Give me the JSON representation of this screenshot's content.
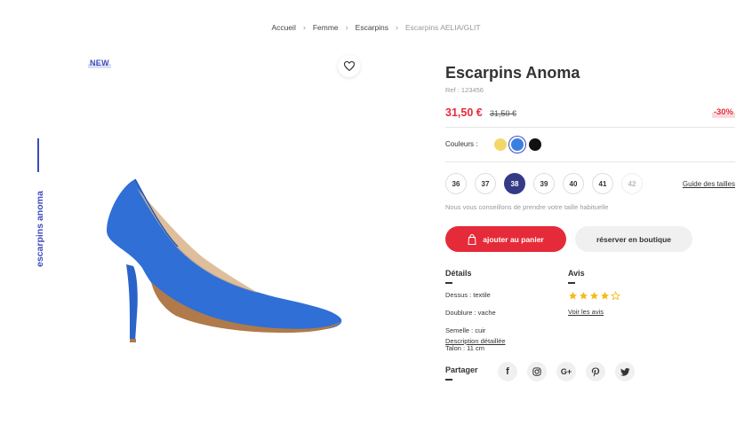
{
  "breadcrumb": {
    "items": [
      "Accueil",
      "Femme",
      "Escarpins"
    ],
    "current": "Escarpins AELIA/GLIT"
  },
  "side_title": "escarpins anoma",
  "badge": "NEW",
  "product": {
    "title": "Escarpins Anoma",
    "ref": "Ref : 123456",
    "price": "31,50 €",
    "old_price": "31,50 €",
    "discount": "-30%"
  },
  "colors": {
    "label": "Couleurs :",
    "swatches": [
      {
        "name": "yellow",
        "hex": "#f2d86a",
        "selected": false
      },
      {
        "name": "blue",
        "hex": "#3b7fe0",
        "selected": true
      },
      {
        "name": "black",
        "hex": "#111111",
        "selected": false
      }
    ]
  },
  "sizes": {
    "options": [
      "36",
      "37",
      "38",
      "39",
      "40",
      "41",
      "42"
    ],
    "selected": "38",
    "unavailable": [
      "42"
    ],
    "guide_label": "Guide des tailles",
    "hint": "Nous vous conseillons de prendre votre taille habituelle"
  },
  "actions": {
    "add_to_cart": "ajouter au panier",
    "reserve": "réserver en boutique"
  },
  "details": {
    "title": "Détails",
    "lines": [
      "Dessus : textile",
      "Doublure : vache",
      "Semelle : cuir"
    ],
    "link": "Description détaillée",
    "heel": "Talon : 11 cm"
  },
  "reviews": {
    "title": "Avis",
    "rating": 4,
    "max": 5,
    "link": "Voir les avis"
  },
  "share": {
    "title": "Partager",
    "networks": [
      "facebook-icon",
      "instagram-icon",
      "google-plus-icon",
      "pinterest-icon",
      "twitter-icon"
    ]
  },
  "colors_theme": {
    "accent": "#3a4bbd",
    "red": "#e52b39",
    "navy": "#343a85",
    "shoe_blue": "#2f6fd6"
  }
}
